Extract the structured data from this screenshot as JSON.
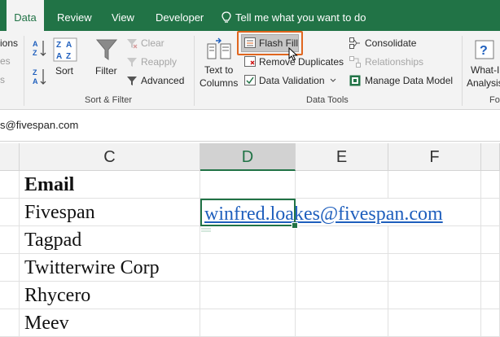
{
  "tabs": {
    "data": "Data",
    "review": "Review",
    "view": "View",
    "developer": "Developer"
  },
  "tell_me": "Tell me what you want to do",
  "ribbon": {
    "connections_partial": "ions",
    "sort_label": "Sort",
    "filter_label": "Filter",
    "clear_label": "Clear",
    "reapply_label": "Reapply",
    "advanced_label": "Advanced",
    "sort_filter_group": "Sort & Filter",
    "text_to_columns_line1": "Text to",
    "text_to_columns_line2": "Columns",
    "flash_fill_label": "Flash Fill",
    "remove_duplicates_label": "Remove Duplicates",
    "data_validation_label": "Data Validation",
    "consolidate_label": "Consolidate",
    "relationships_label": "Relationships",
    "manage_data_model_label": "Manage Data Model",
    "data_tools_group": "Data Tools",
    "what_if_line1": "What-I",
    "what_if_line2": "Analysis",
    "forecast_partial": "Fo"
  },
  "formula_bar": {
    "value": "s@fivespan.com"
  },
  "columns": [
    "C",
    "D",
    "E",
    "F"
  ],
  "rows": [
    {
      "c": "Email",
      "d": ""
    },
    {
      "c": "Fivespan",
      "d": "winfred.loakes@fivespan.com"
    },
    {
      "c": "Tagpad",
      "d": ""
    },
    {
      "c": "Twitterwire Corp",
      "d": ""
    },
    {
      "c": "Rhycero",
      "d": ""
    },
    {
      "c": "Meev",
      "d": ""
    }
  ],
  "colors": {
    "accent": "#217346",
    "highlight": "#e0661f",
    "link": "#1f5fbd"
  }
}
